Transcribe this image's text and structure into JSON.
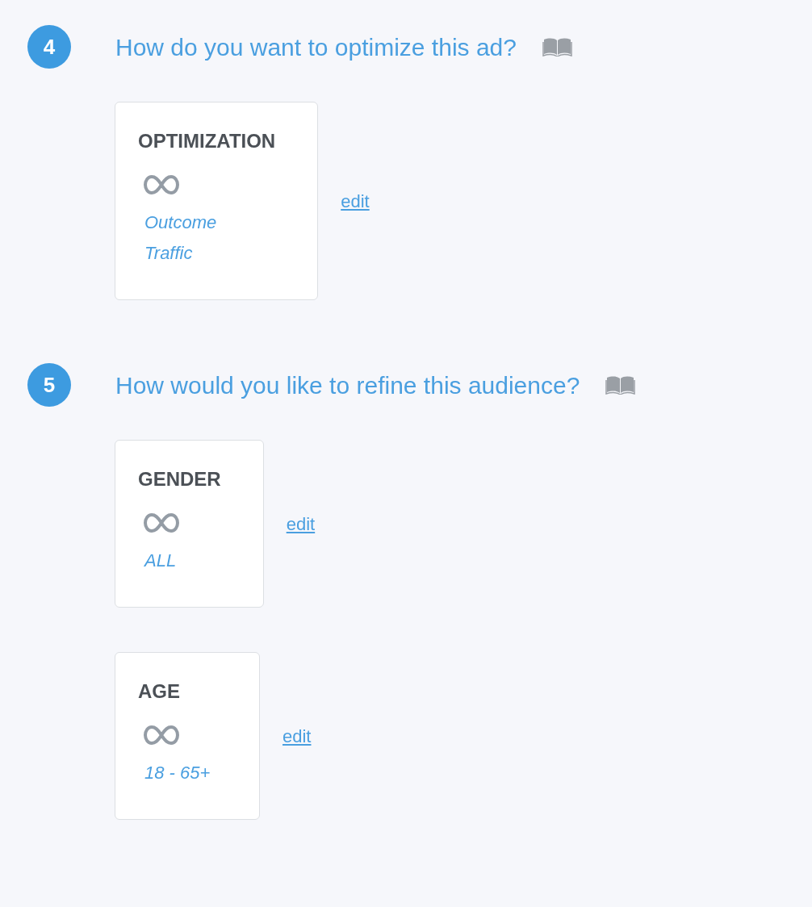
{
  "sections": [
    {
      "number": "4",
      "title": "How do you want to optimize this ad?",
      "cards": [
        {
          "title": "OPTIMIZATION",
          "values": [
            "Outcome",
            "Traffic"
          ],
          "link": "edit"
        }
      ]
    },
    {
      "number": "5",
      "title": "How would you like to refine this audience?",
      "cards": [
        {
          "title": "GENDER",
          "values": [
            "ALL"
          ],
          "link": "edit"
        },
        {
          "title": "AGE",
          "values": [
            "18 - 65+"
          ],
          "link": "edit"
        }
      ]
    }
  ]
}
